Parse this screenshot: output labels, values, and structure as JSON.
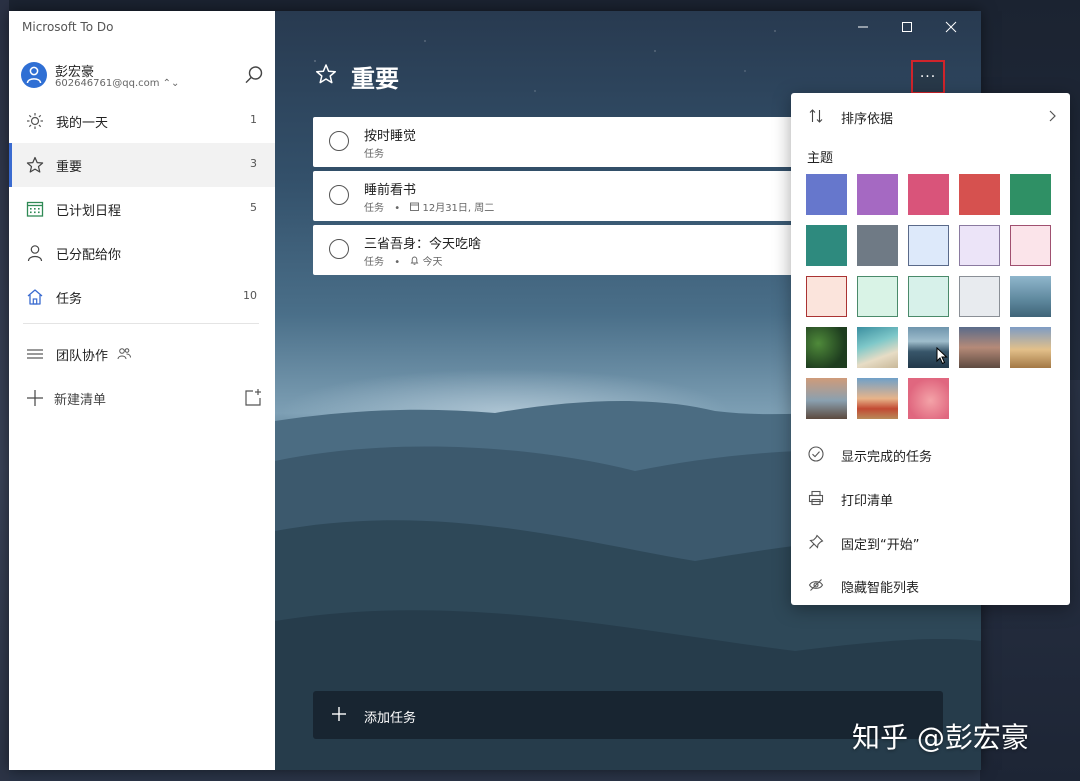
{
  "app": {
    "title": "Microsoft To Do"
  },
  "account": {
    "name": "彭宏豪",
    "email": "602646761@qq.com ⌃⌄"
  },
  "sidebar": {
    "items": [
      {
        "label": "我的一天",
        "count": "1"
      },
      {
        "label": "重要",
        "count": "3"
      },
      {
        "label": "已计划日程",
        "count": "5"
      },
      {
        "label": "已分配给你",
        "count": ""
      },
      {
        "label": "任务",
        "count": "10"
      }
    ],
    "group": {
      "label": "团队协作"
    },
    "new_list": {
      "label": "新建清单"
    }
  },
  "main": {
    "list_title": "重要",
    "more_label": "···",
    "tasks": [
      {
        "title": "按时睡觉",
        "list": "任务",
        "due": "",
        "reminder": ""
      },
      {
        "title": "睡前看书",
        "list": "任务",
        "due": "12月31日, 周二",
        "reminder": ""
      },
      {
        "title": "三省吾身：今天吃啥",
        "list": "任务",
        "due": "",
        "reminder": "今天"
      }
    ],
    "add_task_label": "添加任务"
  },
  "menu": {
    "sort_label": "排序依据",
    "theme_label": "主题",
    "themes": [
      {
        "name": "blue",
        "color": "#6677cc"
      },
      {
        "name": "purple",
        "color": "#a569c2"
      },
      {
        "name": "rose",
        "color": "#d9547a"
      },
      {
        "name": "red",
        "color": "#d6514f"
      },
      {
        "name": "green",
        "color": "#2f9065"
      },
      {
        "name": "teal",
        "color": "#2e8a7e"
      },
      {
        "name": "slate",
        "color": "#6f7a85"
      },
      {
        "name": "light-blue",
        "color": "#dde9fa"
      },
      {
        "name": "light-purple",
        "color": "#ece4f8"
      },
      {
        "name": "light-pink",
        "color": "#fbe4ea"
      },
      {
        "name": "light-peach",
        "color": "#fbe4dc"
      },
      {
        "name": "light-mint",
        "color": "#d9f3e6"
      },
      {
        "name": "light-aqua",
        "color": "#d7f1ea"
      },
      {
        "name": "light-gray",
        "color": "#e8ebef"
      },
      {
        "name": "photo-tower",
        "color": "#7aa0b4"
      },
      {
        "name": "photo-leaves",
        "color": "#2c5a2e"
      },
      {
        "name": "photo-beach",
        "color": "#5aa8b4"
      },
      {
        "name": "photo-desert",
        "color": "#3b6680"
      },
      {
        "name": "photo-palm",
        "color": "#8a7468"
      },
      {
        "name": "photo-dunes",
        "color": "#c69e6a"
      },
      {
        "name": "photo-lighthouse",
        "color": "#b48a70"
      },
      {
        "name": "photo-flower",
        "color": "#c98a5a"
      },
      {
        "name": "photo-pink",
        "color": "#e27a8c"
      }
    ],
    "show_completed": "显示完成的任务",
    "print_list": "打印清单",
    "pin_start": "固定到“开始”",
    "hide_smart": "隐藏智能列表"
  },
  "watermark": "知乎 @彭宏豪"
}
